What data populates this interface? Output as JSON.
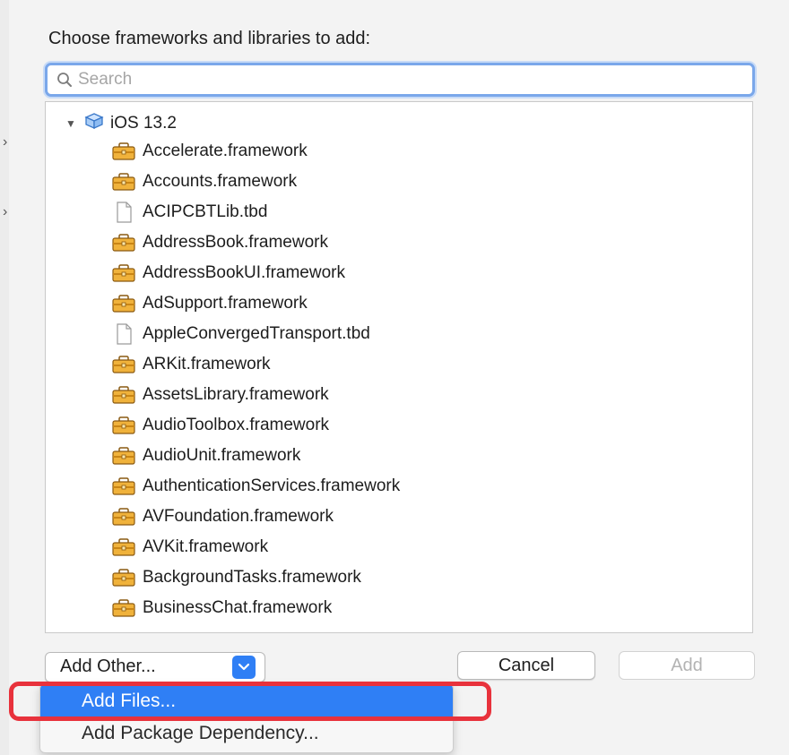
{
  "header": {
    "prompt": "Choose frameworks and libraries to add:"
  },
  "search": {
    "placeholder": "Search",
    "value": ""
  },
  "tree": {
    "root_label": "iOS 13.2",
    "items": [
      {
        "label": "Accelerate.framework",
        "icon": "toolbox-icon"
      },
      {
        "label": "Accounts.framework",
        "icon": "toolbox-icon"
      },
      {
        "label": "ACIPCBTLib.tbd",
        "icon": "document-icon"
      },
      {
        "label": "AddressBook.framework",
        "icon": "toolbox-icon"
      },
      {
        "label": "AddressBookUI.framework",
        "icon": "toolbox-icon"
      },
      {
        "label": "AdSupport.framework",
        "icon": "toolbox-icon"
      },
      {
        "label": "AppleConvergedTransport.tbd",
        "icon": "document-icon"
      },
      {
        "label": "ARKit.framework",
        "icon": "toolbox-icon"
      },
      {
        "label": "AssetsLibrary.framework",
        "icon": "toolbox-icon"
      },
      {
        "label": "AudioToolbox.framework",
        "icon": "toolbox-icon"
      },
      {
        "label": "AudioUnit.framework",
        "icon": "toolbox-icon"
      },
      {
        "label": "AuthenticationServices.framework",
        "icon": "toolbox-icon"
      },
      {
        "label": "AVFoundation.framework",
        "icon": "toolbox-icon"
      },
      {
        "label": "AVKit.framework",
        "icon": "toolbox-icon"
      },
      {
        "label": "BackgroundTasks.framework",
        "icon": "toolbox-icon"
      },
      {
        "label": "BusinessChat.framework",
        "icon": "toolbox-icon"
      }
    ]
  },
  "buttons": {
    "add_other": "Add Other...",
    "cancel": "Cancel",
    "add": "Add"
  },
  "menu": {
    "items": [
      {
        "label": "Add Files...",
        "selected": true
      },
      {
        "label": "Add Package Dependency...",
        "selected": false
      }
    ]
  },
  "colors": {
    "accent": "#2f7ff5",
    "highlight_outline": "#e8323c",
    "toolbox": "#f0b23b"
  }
}
